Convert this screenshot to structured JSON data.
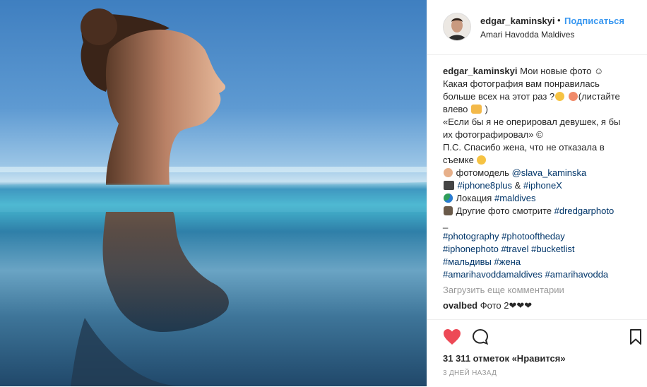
{
  "header": {
    "username": "edgar_kaminskyi",
    "dot": "•",
    "follow_label": "Подписаться",
    "location": "Amari Havodda Maldives"
  },
  "caption": {
    "author": "edgar_kaminskyi",
    "l1": "Мои новые фото ☺",
    "l2": "Какая фотография вам понравилась",
    "l3a": "больше всех на этот раз ?",
    "l3b": "(листайте",
    "l4a": "влево",
    "l4b": ")",
    "l5": "«Если бы я не оперировал девушек, я бы",
    "l6": "их фотографировал» ©",
    "l7": "П.С. Спасибо жена, что не отказала в",
    "l8": "съемке",
    "model_label": "фотомодель",
    "model_handle": "@slava_kaminska",
    "tag_iphone8": "#iphone8plus",
    "amp": "&",
    "tag_iphonex": "#iphoneX",
    "location_label": "Локация",
    "tag_maldives": "#maldives",
    "other_label": "Другие фото смотрите",
    "tag_dredgar": "#dredgarphoto",
    "dash": "_",
    "h1a": "#photography",
    "h1b": "#photooftheday",
    "h2a": "#iphonephoto",
    "h2b": "#travel",
    "h2c": "#bucketlist",
    "h3a": "#мальдивы",
    "h3b": "#жена",
    "h4a": "#amarihavoddamaldives",
    "h4b": "#amarihavodda"
  },
  "load_more": "Загрузить еще комментарии",
  "comment": {
    "author": "ovalbed",
    "text": "Фото 2❤❤❤"
  },
  "likes": "31 311 отметок «Нравится»",
  "time": "3 ДНЕЙ НАЗАД",
  "icons": [
    "heart-icon",
    "comment-icon",
    "bookmark-icon"
  ],
  "colors": {
    "link": "#3897f0",
    "hashtag": "#003569",
    "like": "#ed4956",
    "muted": "#999999"
  }
}
